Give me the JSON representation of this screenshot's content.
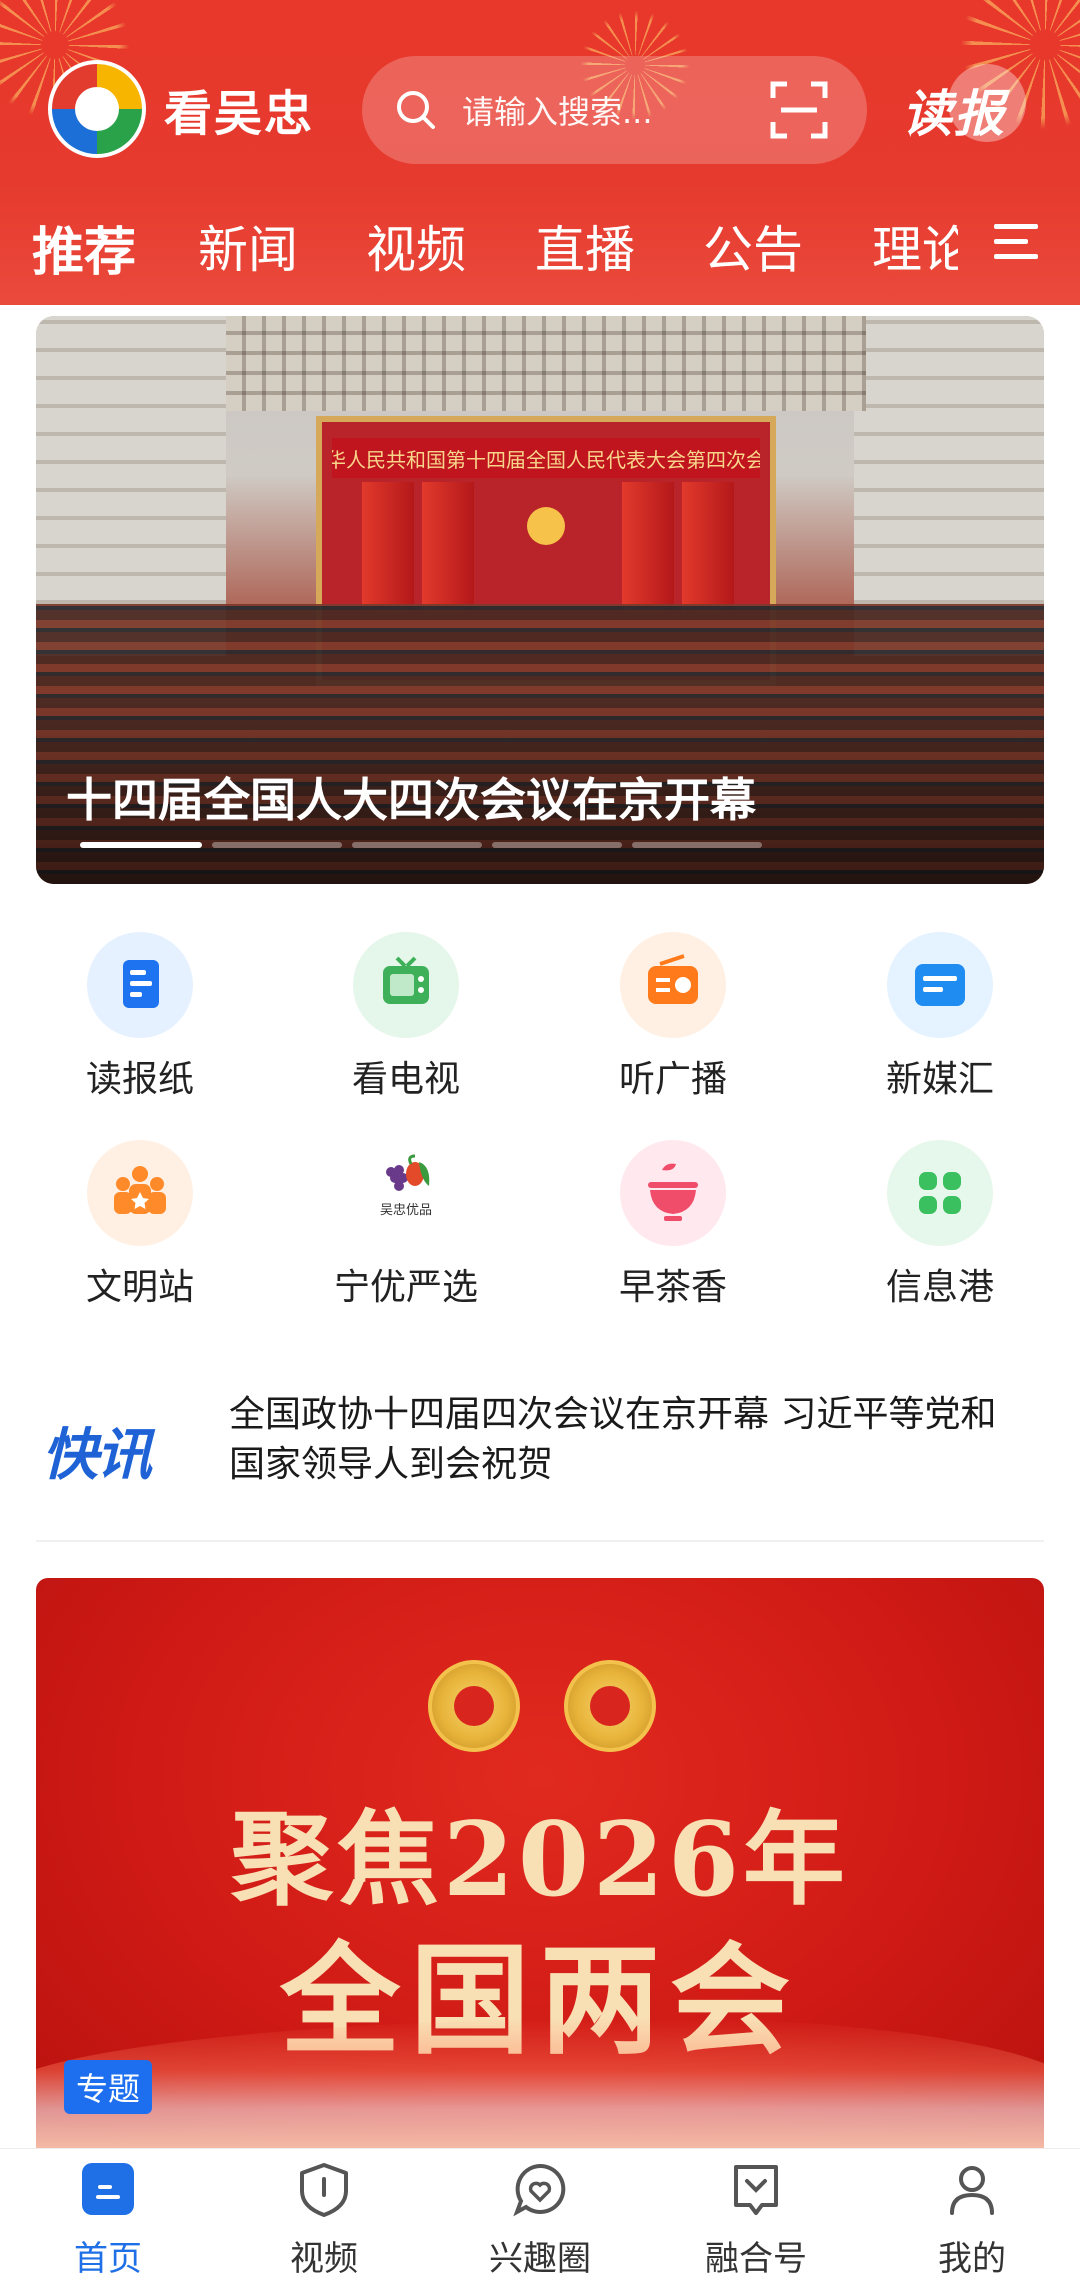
{
  "header": {
    "app_name": "看吴忠",
    "search_placeholder": "请输入搜索...",
    "read_paper_label": "读报"
  },
  "tabs": [
    {
      "label": "推荐",
      "active": true
    },
    {
      "label": "新闻",
      "active": false
    },
    {
      "label": "视频",
      "active": false
    },
    {
      "label": "直播",
      "active": false
    },
    {
      "label": "公告",
      "active": false
    },
    {
      "label": "理论",
      "active": false
    }
  ],
  "banner": {
    "stage_title": "中华人民共和国第十四届全国人民代表大会第四次会议",
    "title": "十四届全国人大四次会议在京开幕",
    "slide_count": 5,
    "active_slide": 1
  },
  "grid": [
    {
      "label": "读报纸",
      "icon": "newspaper-icon",
      "color": "#1e74f0",
      "bg": "#e6f1ff"
    },
    {
      "label": "看电视",
      "icon": "tv-icon",
      "color": "#3fb05a",
      "bg": "#e5f6ea"
    },
    {
      "label": "听广播",
      "icon": "radio-icon",
      "color": "#ff7a1a",
      "bg": "#fff0e3"
    },
    {
      "label": "新媒汇",
      "icon": "media-card-icon",
      "color": "#1e8cf0",
      "bg": "#e4f3ff"
    },
    {
      "label": "文明站",
      "icon": "volunteers-icon",
      "color": "#ff8a2a",
      "bg": "#fff0e3"
    },
    {
      "label": "宁优严选",
      "icon": "produce-logo-icon",
      "sublabel": "吴忠优品",
      "color": "#7a4a2a",
      "bg": "#ffffff"
    },
    {
      "label": "早茶香",
      "icon": "tea-bowl-icon",
      "color": "#f04d6a",
      "bg": "#ffe8ee"
    },
    {
      "label": "信息港",
      "icon": "app-grid-icon",
      "color": "#3ac05e",
      "bg": "#e6f7eb"
    }
  ],
  "flash": {
    "logo_text": "快讯",
    "text": "全国政协十四届四次会议在京开幕 习近平等党和国家领导人到会祝贺"
  },
  "feature": {
    "title_line1": "聚焦2026年",
    "title_line2": "全国两会",
    "badge": "专题"
  },
  "bottom_nav": [
    {
      "label": "首页",
      "icon": "home-icon",
      "active": true
    },
    {
      "label": "视频",
      "icon": "video-shield-icon",
      "active": false
    },
    {
      "label": "兴趣圈",
      "icon": "heart-chat-icon",
      "active": false
    },
    {
      "label": "融合号",
      "icon": "bookmark-chat-icon",
      "active": false
    },
    {
      "label": "我的",
      "icon": "user-icon",
      "active": false
    }
  ],
  "colors": {
    "header_red": "#e8372b",
    "accent_blue": "#1f6fe6",
    "flash_orange": "#f26b1d"
  }
}
